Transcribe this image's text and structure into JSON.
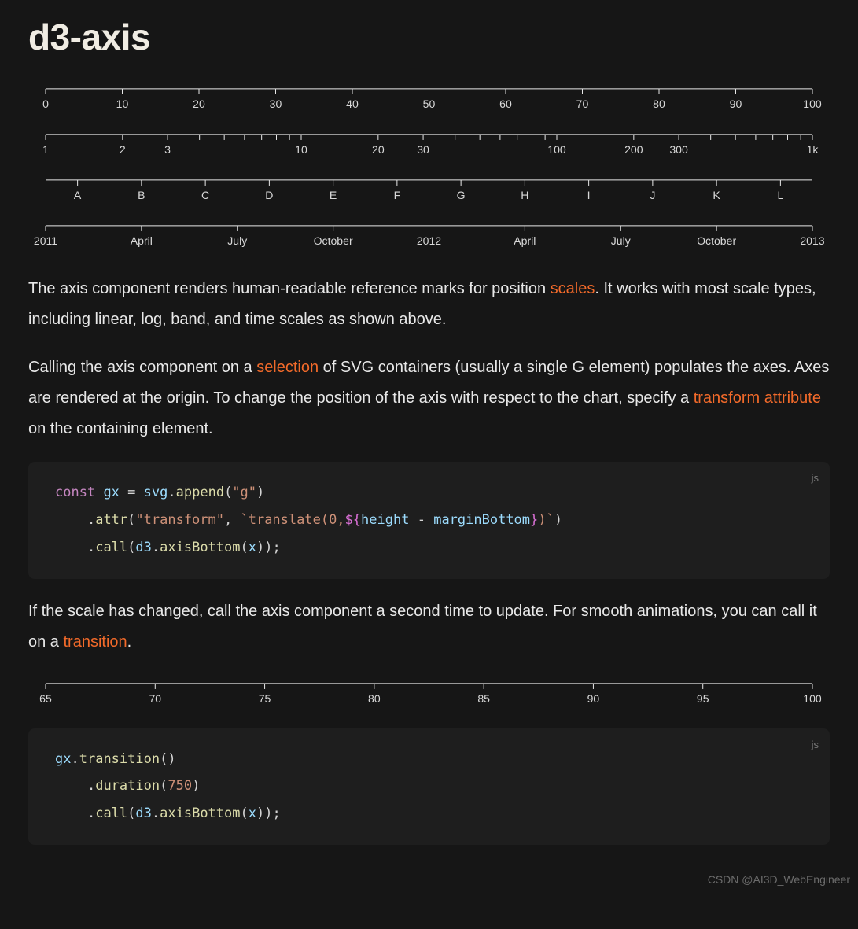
{
  "title": "d3-axis",
  "axes": {
    "linear": {
      "ticks": [
        "0",
        "10",
        "20",
        "30",
        "40",
        "50",
        "60",
        "70",
        "80",
        "90",
        "100"
      ],
      "ends": true
    },
    "log": {
      "majors": [
        "1",
        "2",
        "3",
        "10",
        "20",
        "30",
        "100",
        "200",
        "300",
        "1k"
      ]
    },
    "band": {
      "ticks": [
        "A",
        "B",
        "C",
        "D",
        "E",
        "F",
        "G",
        "H",
        "I",
        "J",
        "K",
        "L"
      ]
    },
    "time": {
      "ticks": [
        "2011",
        "April",
        "July",
        "October",
        "2012",
        "April",
        "July",
        "October",
        "2013"
      ]
    },
    "linear2": {
      "ticks": [
        "65",
        "70",
        "75",
        "80",
        "85",
        "90",
        "95",
        "100"
      ],
      "ends": true
    }
  },
  "paragraphs": {
    "p1_a": "The axis component renders human-readable reference marks for position ",
    "p1_link": "scales",
    "p1_b": ". It works with most scale types, including linear, log, band, and time scales as shown above.",
    "p2_a": "Calling the axis component on a ",
    "p2_link1": "selection",
    "p2_b": " of SVG containers (usually a single G element) populates the axes. Axes are rendered at the origin. To change the position of the axis with respect to the chart, specify a ",
    "p2_link2": "transform attribute",
    "p2_c": " on the containing element.",
    "p3_a": "If the scale has changed, call the axis component a second time to update. For smooth animations, you can call it on a ",
    "p3_link": "transition",
    "p3_b": "."
  },
  "code1": {
    "lang": "js",
    "tokens": {
      "const": "const",
      "gx": "gx",
      "eq": "=",
      "svg": "svg",
      "append": "append",
      "g": "\"g\"",
      "attr": "attr",
      "transform": "\"transform\"",
      "tpl_open": "`translate(0,",
      "brc_open": "${",
      "height": "height",
      "minus": "-",
      "marginBottom": "marginBottom",
      "brc_close": "}",
      "tpl_close": ")`",
      "call": "call",
      "d3": "d3",
      "axisBottom": "axisBottom",
      "x": "x"
    }
  },
  "code2": {
    "lang": "js",
    "tokens": {
      "gx": "gx",
      "transition": "transition",
      "duration": "duration",
      "num": "750",
      "call": "call",
      "d3": "d3",
      "axisBottom": "axisBottom",
      "x": "x"
    }
  },
  "watermark": "CSDN @AI3D_WebEngineer"
}
